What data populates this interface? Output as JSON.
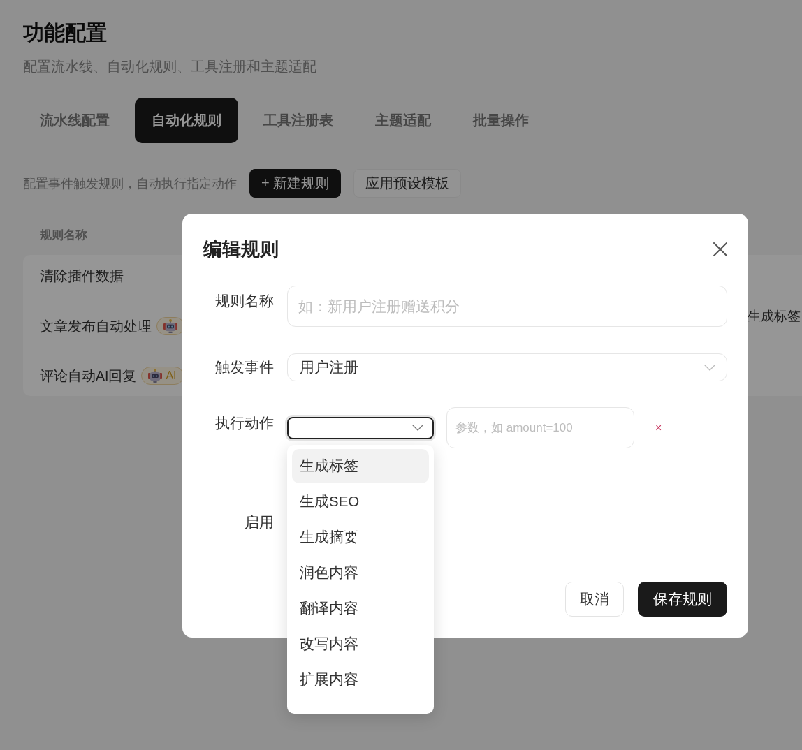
{
  "page": {
    "title": "功能配置",
    "subtitle": "配置流水线、自动化规则、工具注册和主题适配"
  },
  "tabs": [
    {
      "label": "流水线配置",
      "selected": false
    },
    {
      "label": "自动化规则",
      "selected": true
    },
    {
      "label": "工具注册表",
      "selected": false
    },
    {
      "label": "主题适配",
      "selected": false
    },
    {
      "label": "批量操作",
      "selected": false
    }
  ],
  "toolbar": {
    "description": "配置事件触发规则，自动执行指定动作",
    "buttons": [
      {
        "label": "+ 新建规则",
        "kind": "primary"
      },
      {
        "label": "应用预设模板",
        "kind": "secondary"
      }
    ]
  },
  "table": {
    "columns": [
      {
        "label": "规则名称"
      }
    ],
    "rows": [
      {
        "name": "清除插件数据"
      },
      {
        "name": "文章发布自动处理",
        "badge": {
          "kind": "ai"
        },
        "column_2": "生成标签"
      },
      {
        "name": "评论自动AI回复",
        "badge": {
          "kind": "ai",
          "label": "AI"
        }
      }
    ]
  },
  "dialog": {
    "title": "编辑规则",
    "fields": [
      {
        "kind": "text",
        "label": "规则名称",
        "placeholder": "如：新用户注册赠送积分"
      },
      {
        "kind": "select",
        "label": "触发事件",
        "value": "用户注册"
      },
      {
        "kind": "action",
        "label": "执行动作",
        "focused": true,
        "param_placeholder": "参数，如 amount=100",
        "remove_label": "×",
        "options": [
          {
            "label": "生成标签",
            "selected": true
          },
          {
            "label": "生成SEO",
            "selected": false
          },
          {
            "label": "生成摘要",
            "selected": false
          },
          {
            "label": "润色内容",
            "selected": false
          },
          {
            "label": "翻译内容",
            "selected": false
          },
          {
            "label": "改写内容",
            "selected": false
          },
          {
            "label": "扩展内容",
            "selected": false
          }
        ]
      },
      {
        "kind": "toggle",
        "label": "启用"
      }
    ],
    "buttons": [
      {
        "label": "取消",
        "kind": "cancel"
      },
      {
        "label": "保存规则",
        "kind": "save"
      }
    ]
  }
}
